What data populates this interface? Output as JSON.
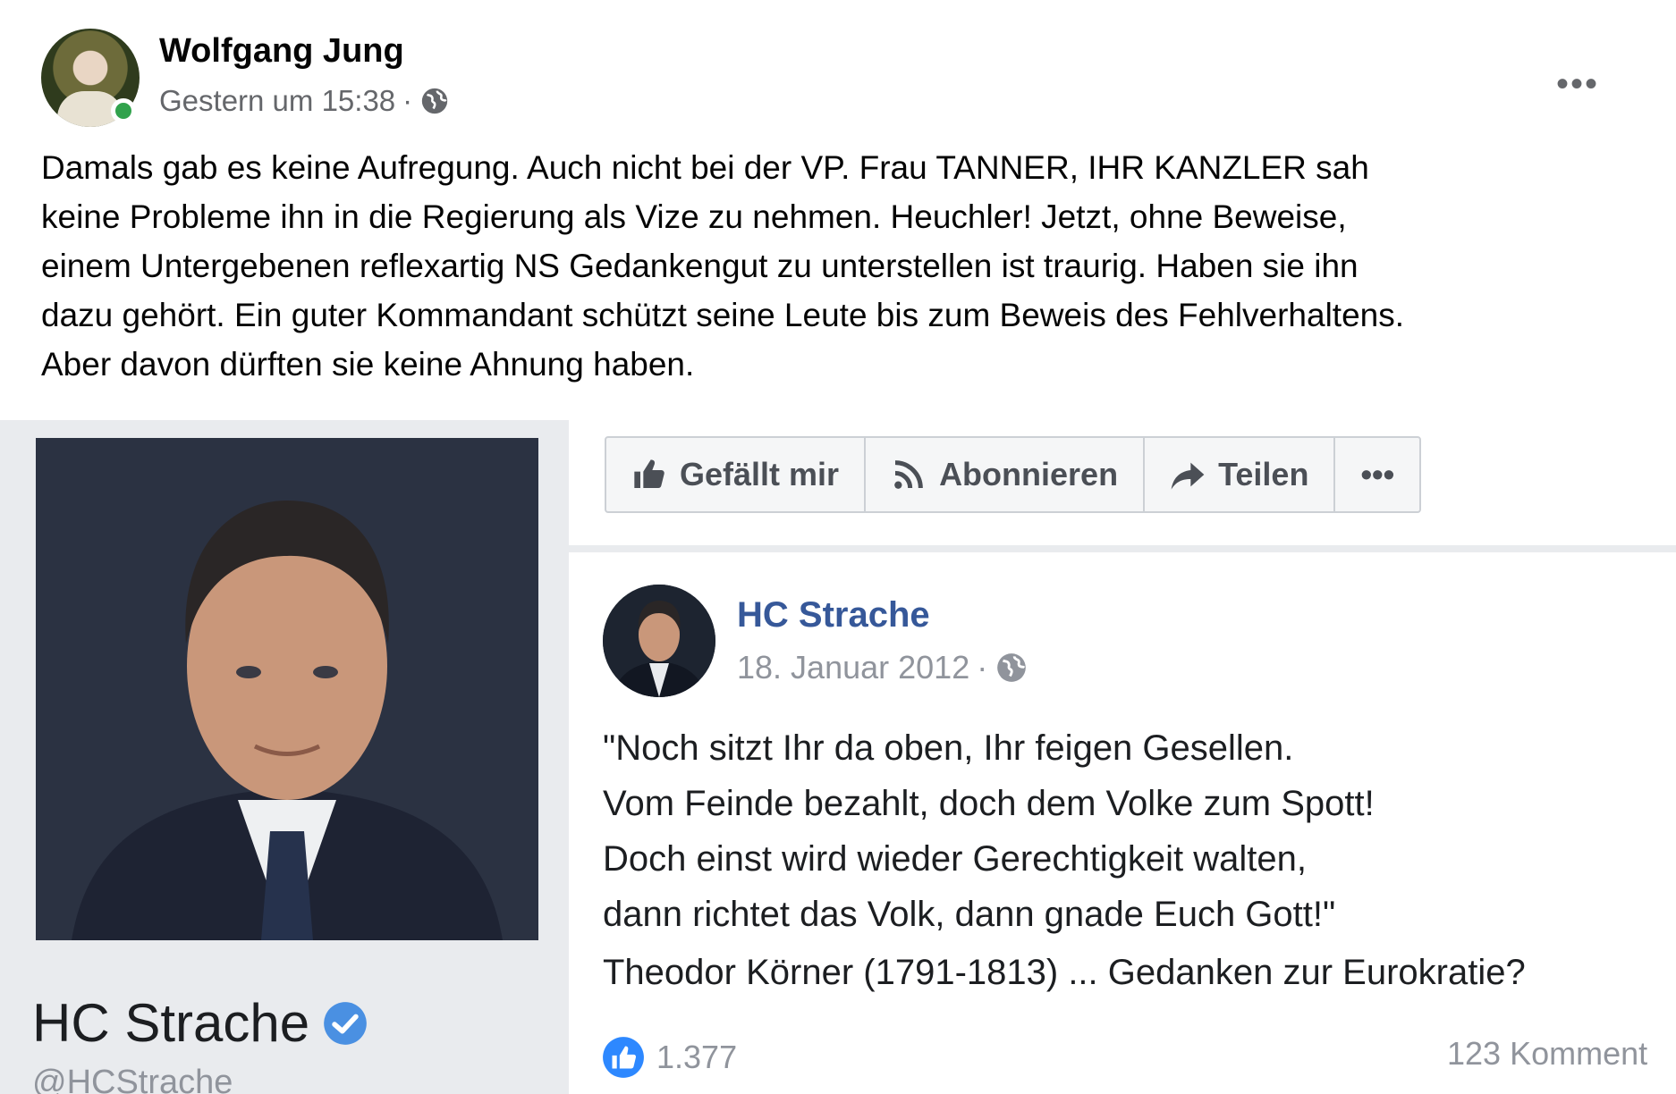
{
  "post": {
    "author": "Wolfgang Jung",
    "timestamp": "Gestern um 15:38",
    "separator": "·",
    "privacy_icon": "globe-icon",
    "more_label": "•••",
    "text": "Damals gab es keine Aufregung. Auch nicht bei  der VP. Frau TANNER, IHR KANZLER sah\nkeine Probleme ihn in die Regierung als Vize zu nehmen. Heuchler! Jetzt, ohne Beweise,\neinem Untergebenen reflexartig  NS  Gedankengut zu unterstellen ist traurig. Haben sie ihn\ndazu gehört. Ein guter Kommandant schützt seine Leute bis zum Beweis des Fehlverhaltens.\nAber davon dürften sie keine Ahnung haben."
  },
  "shared": {
    "profile": {
      "name": "HC Strache",
      "handle": "@HCStrache",
      "verified_icon": "verified-badge-icon"
    },
    "actions": [
      {
        "label": "Gefällt mir",
        "icon": "thumbs-up-icon"
      },
      {
        "label": "Abonnieren",
        "icon": "rss-icon"
      },
      {
        "label": "Teilen",
        "icon": "share-arrow-icon"
      },
      {
        "label": "•••",
        "icon": "more-icon"
      }
    ],
    "embedded_post": {
      "author": "HC Strache",
      "date": "18. Januar 2012",
      "separator": "·",
      "quote": "\"Noch sitzt Ihr da oben, Ihr feigen Gesellen.\nVom Feinde bezahlt, doch dem Volke zum Spott!\nDoch einst wird wieder Gerechtigkeit walten,\ndann richtet das Volk, dann gnade Euch Gott!\"",
      "attribution": "Theodor Körner (1791-1813) ... Gedanken zur Eurokratie?",
      "like_count": "1.377",
      "comments": "123 Komment"
    }
  },
  "colors": {
    "link_blue": "#365899",
    "online_green": "#31a24c",
    "secondary_text": "#65676b",
    "shared_background": "#e9ebee"
  }
}
